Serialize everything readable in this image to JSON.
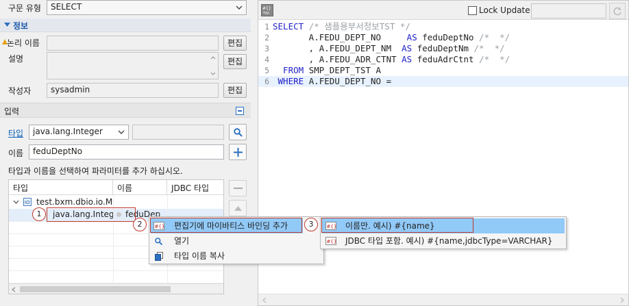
{
  "query_type": {
    "label": "구문 유형",
    "value": "SELECT"
  },
  "info_section": {
    "title": "정보"
  },
  "logical_name": {
    "label": "논리 이름",
    "value": "",
    "edit_label": "편집"
  },
  "description": {
    "label": "설명",
    "value": "",
    "edit_label": "편집"
  },
  "author": {
    "label": "작성자",
    "value": "sysadmin",
    "edit_label": "편집"
  },
  "input_section": {
    "title": "입력"
  },
  "type_row": {
    "label": "타입",
    "value": "java.lang.Integer",
    "filter_value": ""
  },
  "name_row": {
    "label": "이름",
    "value": "feduDeptNo"
  },
  "hint": "타입과 이름을 선택하여 파라미터를 추가 하십시오.",
  "table": {
    "columns": [
      "타입",
      "이름",
      "JDBC 타입"
    ],
    "parent_row": {
      "label": "test.bxm.dbio.io.MyI"
    },
    "child_row": {
      "type": "java.lang.Integer",
      "name": "feduDep"
    }
  },
  "callouts": [
    "1",
    "2",
    "3"
  ],
  "context_menu": {
    "items": [
      {
        "label": "편집기에 마이바티스 바인딩 추가",
        "icon": "mybatis-icon"
      },
      {
        "label": "열기",
        "icon": "search-icon"
      },
      {
        "label": "타입 이름 복사",
        "icon": "copy-icon"
      }
    ]
  },
  "submenu": {
    "items": [
      {
        "label": "이름만. 예시) #{name}",
        "icon": "mybatis-icon"
      },
      {
        "label": "JDBC 타입 포함. 예시) #{name,jdbcType=VARCHAR}",
        "icon": "mybatis-icon"
      }
    ]
  },
  "editor": {
    "lock_label": "Lock Update",
    "lock_checked": false,
    "lock_input": "",
    "line_numbers": [
      "1",
      "2",
      "3",
      "4",
      "5",
      "6"
    ],
    "lines": [
      [
        {
          "t": "SELECT ",
          "c": "kw"
        },
        {
          "t": "/* 샘플용부서정보TST */",
          "c": "cm"
        }
      ],
      [
        {
          "t": "       A.FEDU_DEPT_NO     ",
          "c": ""
        },
        {
          "t": "AS",
          "c": "kw"
        },
        {
          "t": " feduDeptNo ",
          "c": ""
        },
        {
          "t": "/*  */",
          "c": "cm"
        }
      ],
      [
        {
          "t": "       , A.FEDU_DEPT_NM  ",
          "c": ""
        },
        {
          "t": "AS",
          "c": "kw"
        },
        {
          "t": " feduDeptNm ",
          "c": ""
        },
        {
          "t": "/*  */",
          "c": "cm"
        }
      ],
      [
        {
          "t": "       , A.FEDU_ADR_CTNT ",
          "c": ""
        },
        {
          "t": "AS",
          "c": "kw"
        },
        {
          "t": " feduAdrCtnt ",
          "c": ""
        },
        {
          "t": "/*  */",
          "c": "cm"
        }
      ],
      [
        {
          "t": "  FROM ",
          "c": "kw"
        },
        {
          "t": "SMP_DEPT_TST A",
          "c": ""
        }
      ],
      [
        {
          "t": " WHERE ",
          "c": "kw"
        },
        {
          "t": "A.FEDU_DEPT_NO =",
          "c": ""
        }
      ]
    ]
  },
  "colors": {
    "keyword": "#1f1fc9",
    "comment": "#9aa0a6",
    "current_line": "#e8f2fe",
    "menu_selected": "#91c9f7",
    "callout_border": "#c0392b",
    "link": "#0b5fb8"
  }
}
